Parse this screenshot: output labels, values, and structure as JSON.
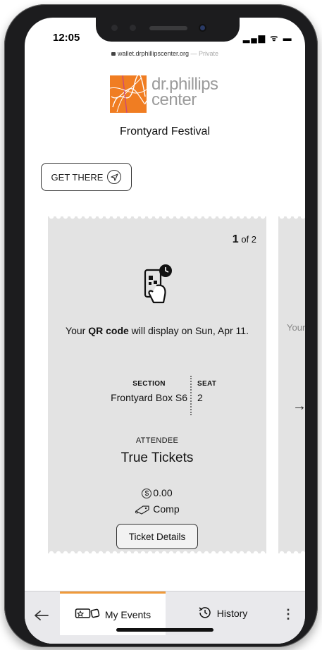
{
  "status_bar": {
    "time": "12:05",
    "signal_icons": "signal-wifi-battery"
  },
  "browser": {
    "url": "wallet.drphillipscenter.org",
    "privacy": "— Private"
  },
  "brand": {
    "line1": "dr.phillips",
    "line2": "center",
    "accent_color": "#f07d22"
  },
  "event": {
    "title": "Frontyard Festival"
  },
  "actions": {
    "get_there_label": "GET THERE"
  },
  "ticket": {
    "index": "1",
    "of_total": "of 2",
    "qr_message_prefix": "Your ",
    "qr_message_bold": "QR code",
    "qr_message_suffix": " will display on Sun, Apr 11.",
    "section_label": "SECTION",
    "section_value": "Frontyard Box S6",
    "seat_label": "SEAT",
    "seat_value": "2",
    "attendee_label": "ATTENDEE",
    "attendee_name": "True Tickets",
    "price_symbol": "$",
    "price": "0.00",
    "type": "Comp",
    "details_button": "Ticket Details"
  },
  "next_ticket": {
    "text_fragment": "Your",
    "arrow": "→"
  },
  "tabbar": {
    "back_icon": "←",
    "my_events_label": "My Events",
    "history_label": "History",
    "more_icon": "⋮",
    "active_color": "#f09a3a"
  }
}
